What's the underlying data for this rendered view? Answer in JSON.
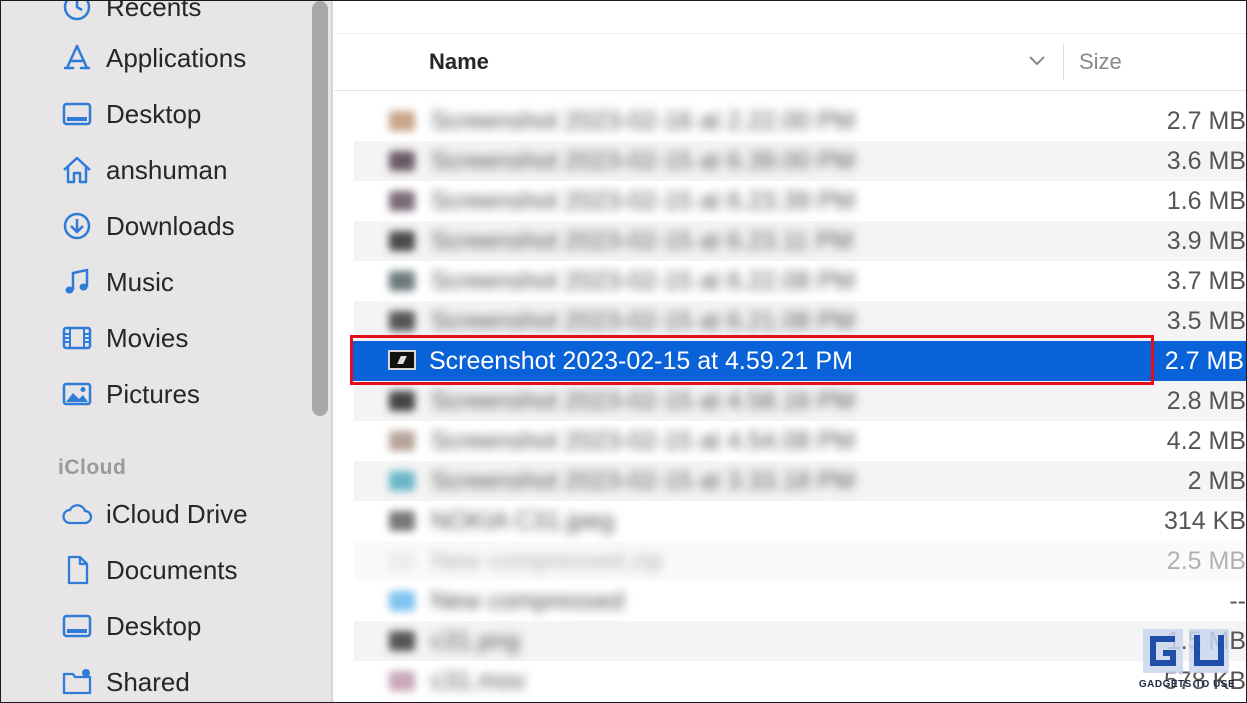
{
  "sidebar": {
    "items": [
      {
        "label": "Recents",
        "icon": "clock-icon"
      },
      {
        "label": "Applications",
        "icon": "applications-icon"
      },
      {
        "label": "Desktop",
        "icon": "desktop-icon"
      },
      {
        "label": "anshuman",
        "icon": "home-icon"
      },
      {
        "label": "Downloads",
        "icon": "download-icon"
      },
      {
        "label": "Music",
        "icon": "music-icon"
      },
      {
        "label": "Movies",
        "icon": "film-icon"
      },
      {
        "label": "Pictures",
        "icon": "picture-icon"
      }
    ],
    "icloud_section": "iCloud",
    "icloud_items": [
      {
        "label": "iCloud Drive",
        "icon": "cloud-icon"
      },
      {
        "label": "Documents",
        "icon": "document-icon"
      },
      {
        "label": "Desktop",
        "icon": "desktop-icon"
      },
      {
        "label": "Shared",
        "icon": "shared-folder-icon"
      }
    ]
  },
  "list": {
    "columns": {
      "name": "Name",
      "size": "Size"
    },
    "rows": [
      {
        "name": "Screenshot 2023-02-16 at 2.22.00 PM",
        "size": "2.7 MB",
        "icon_color": "#c9a58a"
      },
      {
        "name": "Screenshot 2023-02-15 at 6.39.00 PM",
        "size": "3.6 MB",
        "icon_color": "#6a5a66"
      },
      {
        "name": "Screenshot 2023-02-15 at 6.23.39 PM",
        "size": "1.6 MB",
        "icon_color": "#7a6a78"
      },
      {
        "name": "Screenshot 2023-02-15 at 6.23.11 PM",
        "size": "3.9 MB",
        "icon_color": "#4a4a4a"
      },
      {
        "name": "Screenshot 2023-02-15 at 6.22.08 PM",
        "size": "3.7 MB",
        "icon_color": "#6c7a7e"
      },
      {
        "name": "Screenshot 2023-02-15 at 6.21.08 PM",
        "size": "3.5 MB",
        "icon_color": "#555555"
      },
      {
        "name": "Screenshot 2023-02-15 at 4.59.21 PM",
        "size": "2.7 MB",
        "selected": true
      },
      {
        "name": "Screenshot 2023-02-15 at 4.58.16 PM",
        "size": "2.8 MB",
        "icon_color": "#444444"
      },
      {
        "name": "Screenshot 2023-02-15 at 4.54.08 PM",
        "size": "4.2 MB",
        "icon_color": "#b8a49a"
      },
      {
        "name": "Screenshot 2023-02-15 at 3.33.18 PM",
        "size": "2 MB",
        "icon_color": "#6ab6c8"
      },
      {
        "name": "NOKIA C31.jpeg",
        "size": "314 KB",
        "icon_color": "#777777"
      },
      {
        "name": "New compressed.zip",
        "size": "2.5 MB",
        "icon_color": "#d8d8d8",
        "dim": true
      },
      {
        "name": "New compressed",
        "size": "--",
        "icon_color": "#7dc3ef"
      },
      {
        "name": "c31.png",
        "size": "1.5 MB",
        "icon_color": "#555555"
      },
      {
        "name": "c31.mov",
        "size": "578 KB",
        "icon_color": "#c8a8b8"
      }
    ]
  },
  "watermark": {
    "text": "GADGETS TO USE"
  }
}
